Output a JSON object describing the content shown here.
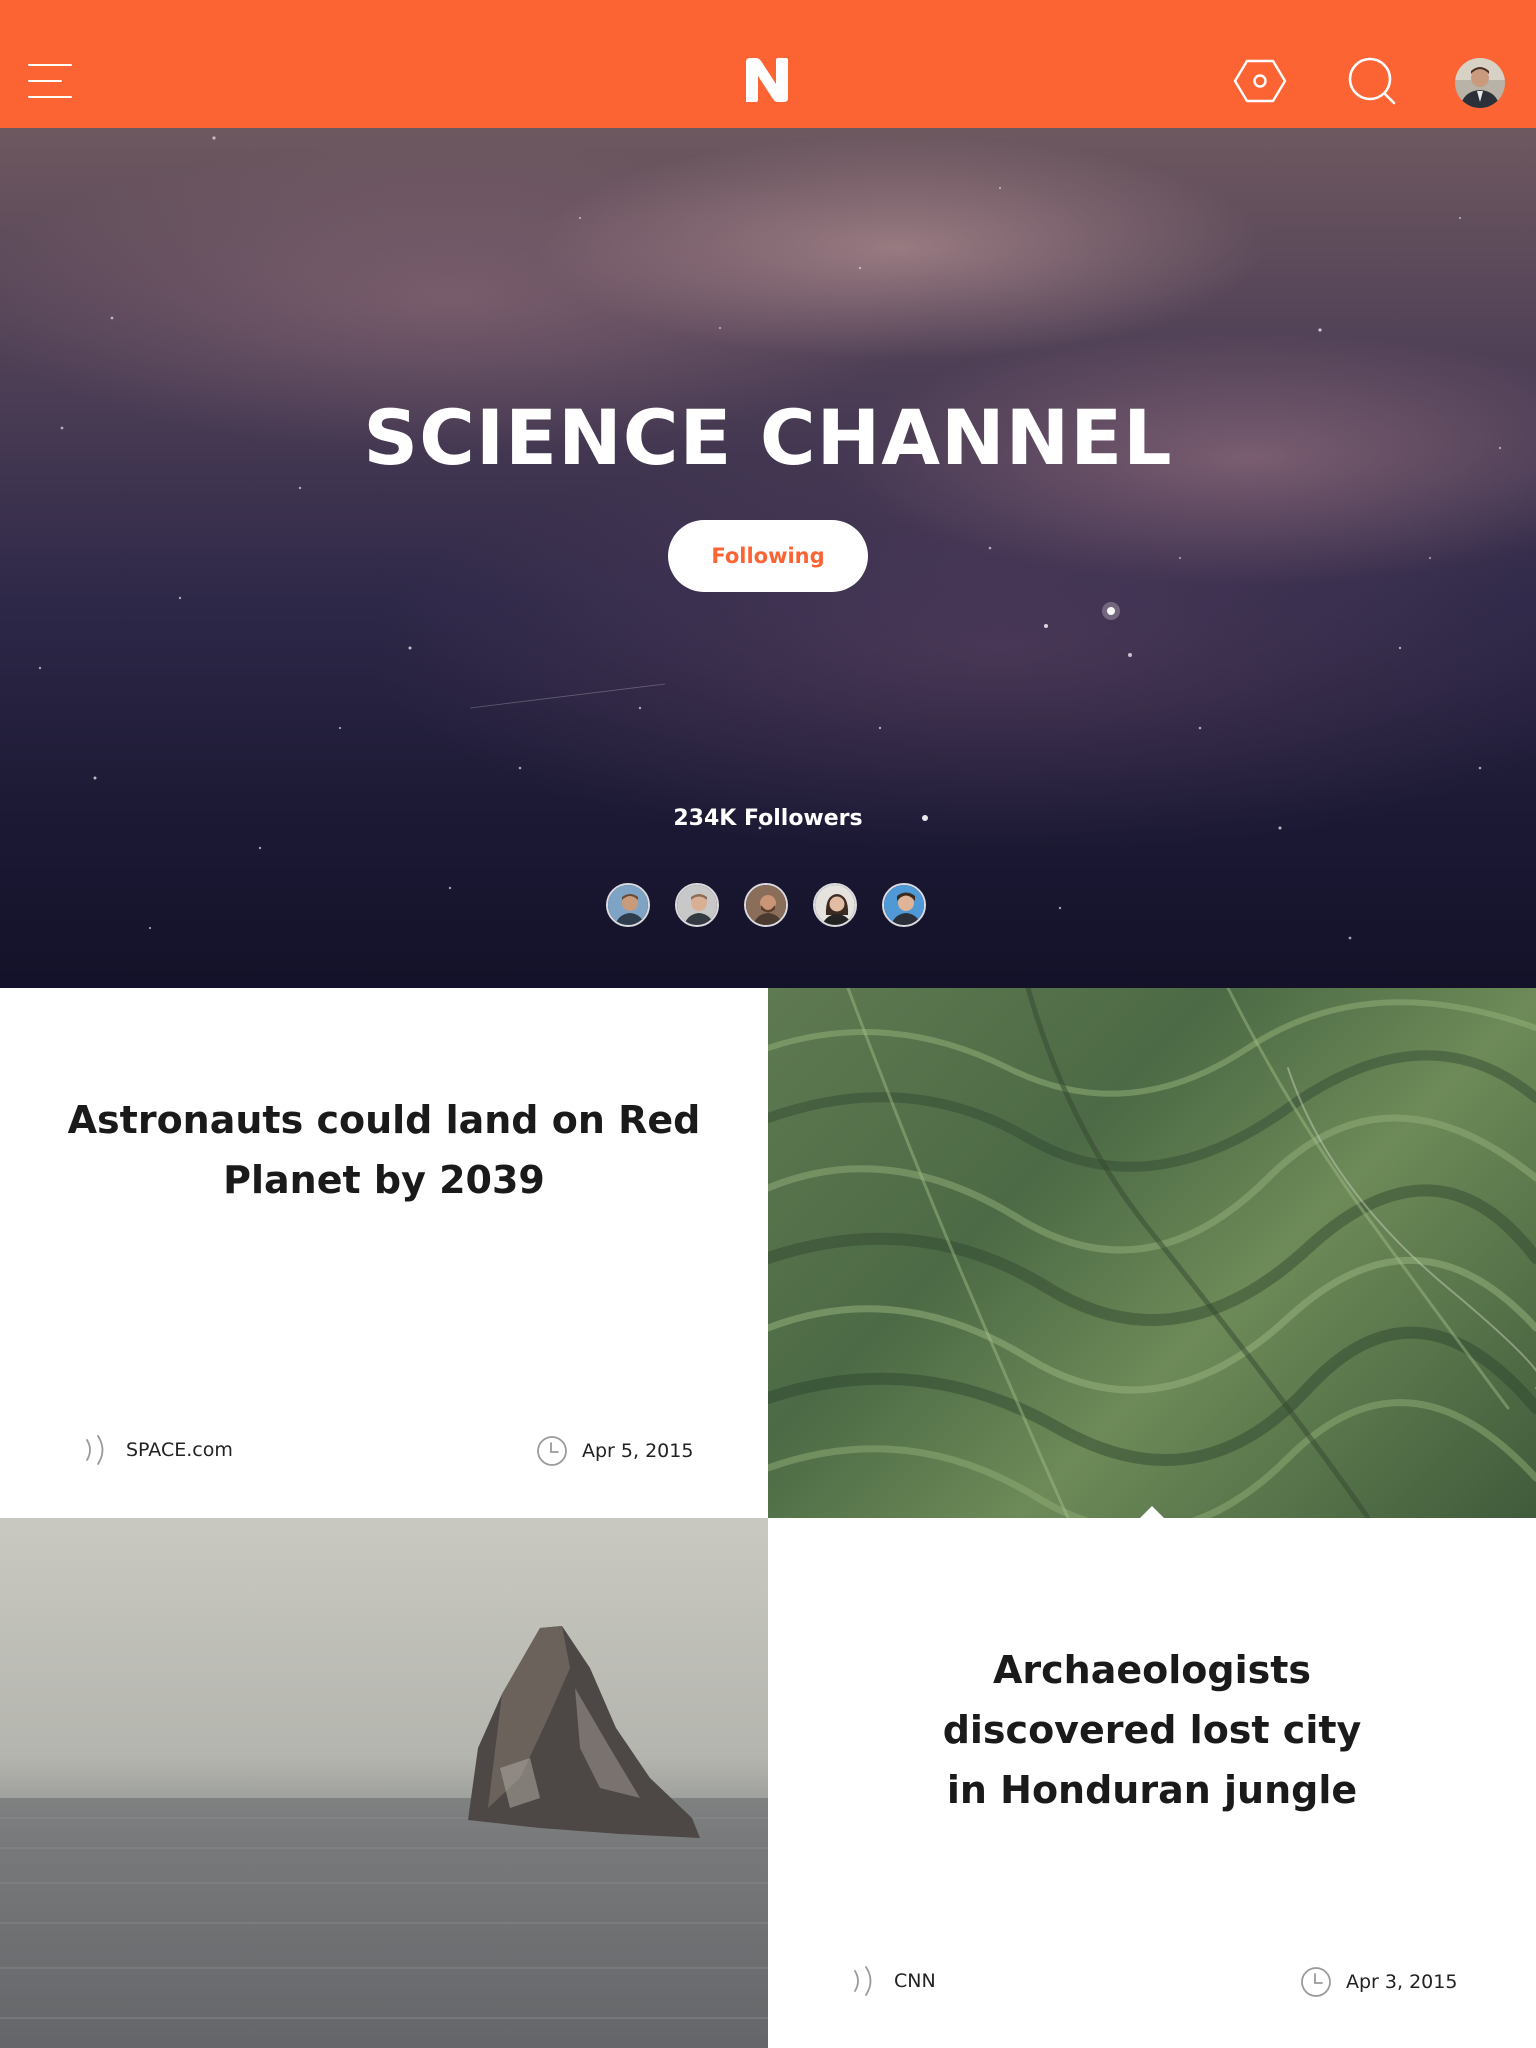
{
  "app": {
    "logo_letter": "N",
    "accent_color": "#fc6434"
  },
  "header": {
    "menu_icon": "hamburger-menu-icon",
    "settings_icon": "hexagon-settings-icon",
    "search_icon": "search-icon",
    "profile_icon": "profile-avatar"
  },
  "channel": {
    "title": "SCIENCE CHANNEL",
    "follow_label": "Following",
    "followers": "234K Followers"
  },
  "articles": [
    {
      "headline": "Astronauts could land on Red Planet by 2039",
      "source": "SPACE.com",
      "date": "Apr 5, 2015",
      "image": "aerial green mountain ridges"
    },
    {
      "headline": "Archaeologists discovered lost city in Honduran jungle",
      "source": "CNN",
      "date": "Apr 3, 2015",
      "image": "sea rock in misty ocean"
    }
  ]
}
